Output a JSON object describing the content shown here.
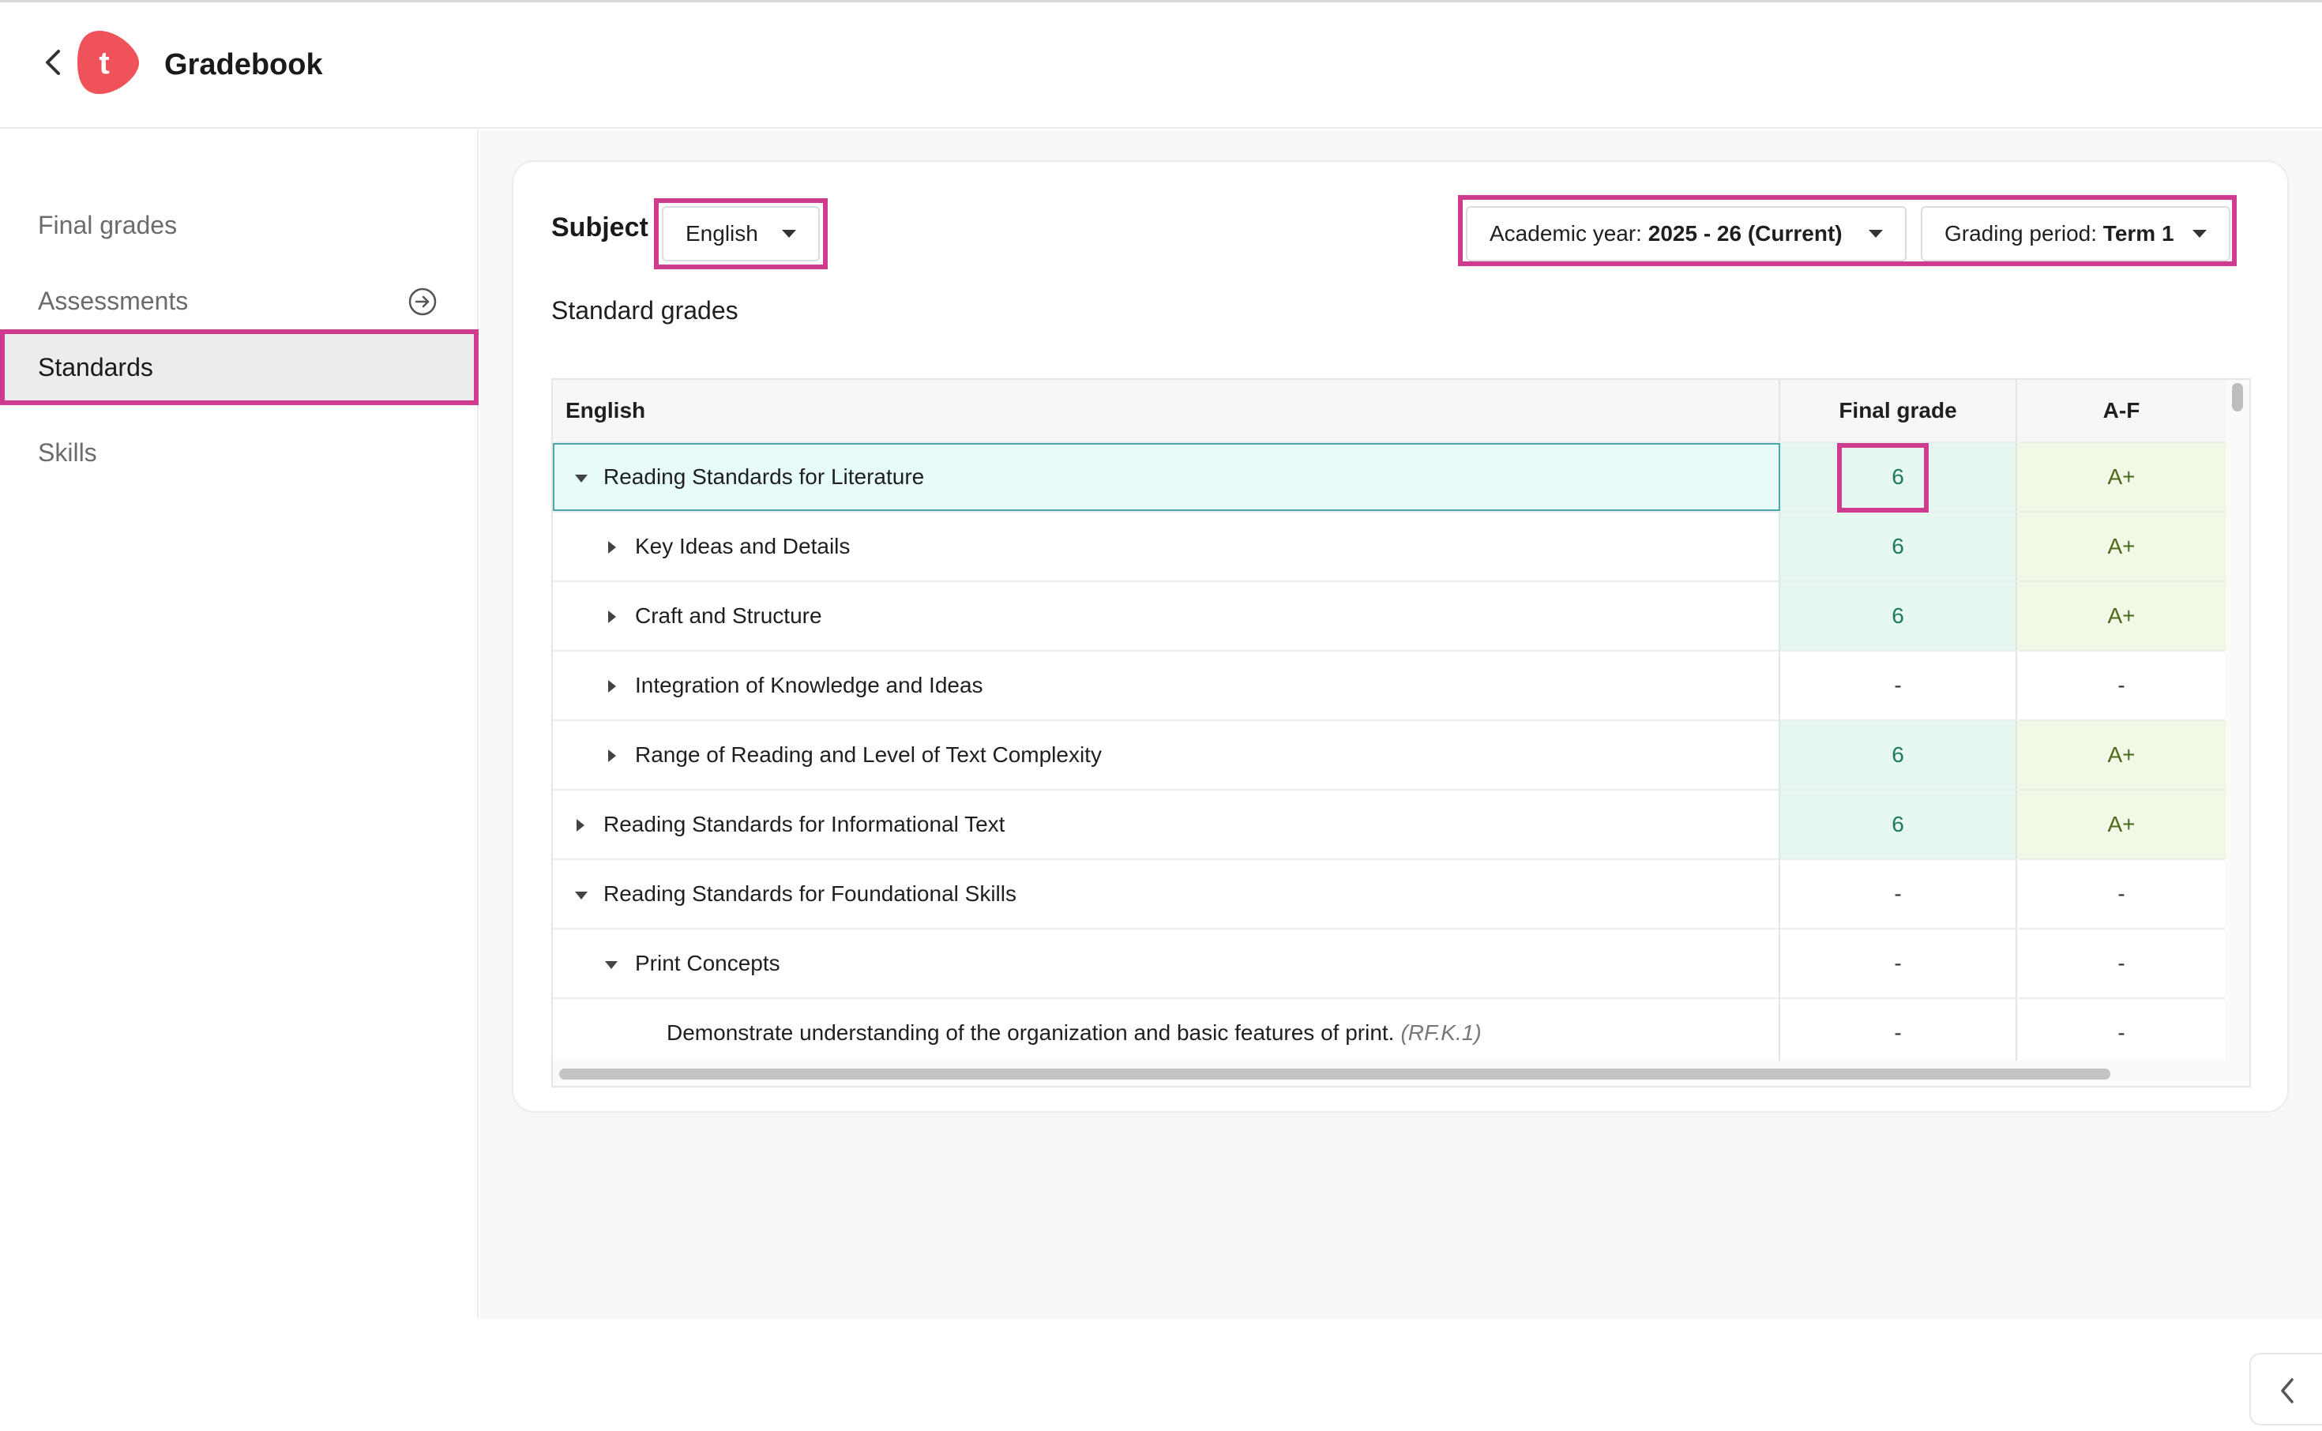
{
  "header": {
    "title": "Gradebook",
    "logo_letter": "t",
    "brand_color": "#f0525a"
  },
  "sidebar": {
    "items": [
      {
        "label": "Final grades"
      },
      {
        "label": "Assessments",
        "icon": "arrow-circle-right-icon"
      },
      {
        "label": "Standards",
        "active": true
      },
      {
        "label": "Skills"
      }
    ]
  },
  "filters": {
    "subject_label": "Subject",
    "subject_value": "English",
    "academic_year_label": "Academic year:",
    "academic_year_value": "2025 - 26 (Current)",
    "grading_period_label": "Grading period:",
    "grading_period_value": "Term 1"
  },
  "section_title": "Standard grades",
  "table": {
    "columns": [
      "English",
      "Final grade",
      "A-F"
    ],
    "rows": [
      {
        "name": "Reading Standards for Literature",
        "final": "6",
        "af": "A+"
      },
      {
        "name": "Key Ideas and Details",
        "final": "6",
        "af": "A+"
      },
      {
        "name": "Craft and Structure",
        "final": "6",
        "af": "A+"
      },
      {
        "name": "Integration of Knowledge and Ideas",
        "final": "-",
        "af": "-"
      },
      {
        "name": "Range of Reading and Level of Text Complexity",
        "final": "6",
        "af": "A+"
      },
      {
        "name": "Reading Standards for Informational Text",
        "final": "6",
        "af": "A+"
      },
      {
        "name": "Reading Standards for Foundational Skills",
        "final": "-",
        "af": "-"
      },
      {
        "name": "Print Concepts",
        "final": "-",
        "af": "-"
      },
      {
        "name": "Demonstrate understanding of the organization and basic features of print.",
        "code": "(RF.K.1)",
        "final": "-",
        "af": "-"
      }
    ]
  },
  "colors": {
    "highlight": "#cf3c8f",
    "grade_text": "#1b7a5e",
    "letter_text": "#4a6b1a"
  }
}
